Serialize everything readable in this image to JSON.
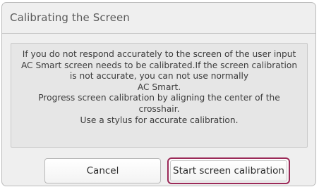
{
  "dialog": {
    "title": "Calibrating the Screen",
    "message_lines": [
      "If you do not respond accurately to the screen of the user input",
      "AC Smart screen needs to be calibrated.If the screen calibration",
      "is not accurate, you can not use normally",
      "AC Smart.",
      "Progress screen calibration by aligning the center of the",
      "crosshair.",
      "Use a stylus for accurate calibration."
    ],
    "cancel_label": "Cancel",
    "start_label": "Start screen calibration"
  },
  "colors": {
    "dialog_background": "#efefef",
    "message_background": "#e6e6e6",
    "focus_border": "#9b2a58"
  }
}
